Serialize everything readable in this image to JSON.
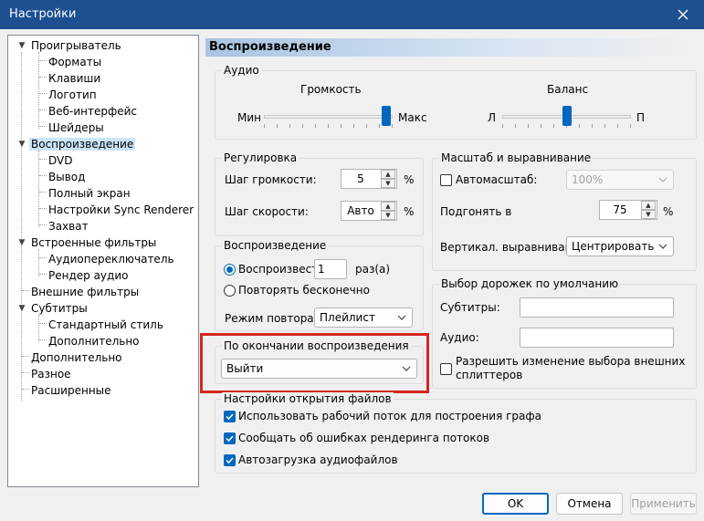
{
  "window": {
    "title": "Настройки"
  },
  "tree": {
    "items": [
      {
        "label": "Проигрыватель"
      },
      {
        "label": "Форматы"
      },
      {
        "label": "Клавиши"
      },
      {
        "label": "Логотип"
      },
      {
        "label": "Веб-интерфейс"
      },
      {
        "label": "Шейдеры"
      },
      {
        "label": "Воспроизведение"
      },
      {
        "label": "DVD"
      },
      {
        "label": "Вывод"
      },
      {
        "label": "Полный экран"
      },
      {
        "label": "Настройки Sync Renderer"
      },
      {
        "label": "Захват"
      },
      {
        "label": "Встроенные фильтры"
      },
      {
        "label": "Аудиопереключатель"
      },
      {
        "label": "Рендер аудио"
      },
      {
        "label": "Внешние фильтры"
      },
      {
        "label": "Субтитры"
      },
      {
        "label": "Стандартный стиль"
      },
      {
        "label": "Дополнительно"
      },
      {
        "label": "Дополнительно"
      },
      {
        "label": "Разное"
      },
      {
        "label": "Расширенные"
      }
    ]
  },
  "panel": {
    "title": "Воспроизведение"
  },
  "audio": {
    "label": "Аудио",
    "volume": {
      "title": "Громкость",
      "min_label": "Мин",
      "max_label": "Макс",
      "level": 0.95
    },
    "balance": {
      "title": "Баланс",
      "left_label": "Л",
      "right_label": "П",
      "level": 0.5
    }
  },
  "regulation": {
    "label": "Регулировка",
    "volume_step": {
      "label": "Шаг громкости:",
      "value": "5",
      "unit": "%"
    },
    "speed_step": {
      "label": "Шаг скорости:",
      "value": "Авто",
      "unit": "%"
    }
  },
  "scale": {
    "label": "Масштаб и выравнивание",
    "autozoom": {
      "label": "Автомасштаб:",
      "checked": false,
      "value": "100%"
    },
    "fit": {
      "label": "Подгонять в",
      "value": "75",
      "unit": "%"
    },
    "valign": {
      "label": "Вертикал. выравнивание:",
      "value": "Центрировать"
    }
  },
  "playback": {
    "label": "Воспроизведение",
    "play_times": {
      "label": "Воспроизвести",
      "value": "1",
      "suffix": "раз(а)",
      "checked": true
    },
    "repeat_forever": {
      "label": "Повторять бесконечно",
      "checked": false
    },
    "repeat_mode": {
      "label": "Режим повтора:",
      "value": "Плейлист"
    }
  },
  "after_playback": {
    "label": "По окончании воспроизведения",
    "value": "Выйти",
    "highlight_color": "#d6261f"
  },
  "tracks": {
    "label": "Выбор дорожек по умолчанию",
    "subtitles_label": "Субтитры:",
    "audio_label": "Аудио:",
    "allow_external": {
      "label_line1": "Разрешить изменение выбора внешних",
      "label_line2": "сплиттеров",
      "checked": false
    }
  },
  "file_open": {
    "label": "Настройки открытия файлов",
    "options": [
      {
        "label": "Использовать рабочий поток для построения графа",
        "checked": true
      },
      {
        "label": "Сообщать об ошибках рендеринга потоков",
        "checked": true
      },
      {
        "label": "Автозагрузка аудиофайлов",
        "checked": true
      }
    ]
  },
  "buttons": {
    "ok": "OK",
    "cancel": "Отмена",
    "apply": "Применить"
  },
  "colors": {
    "accent": "#0067c0",
    "titlebar": "#1d4f91"
  }
}
